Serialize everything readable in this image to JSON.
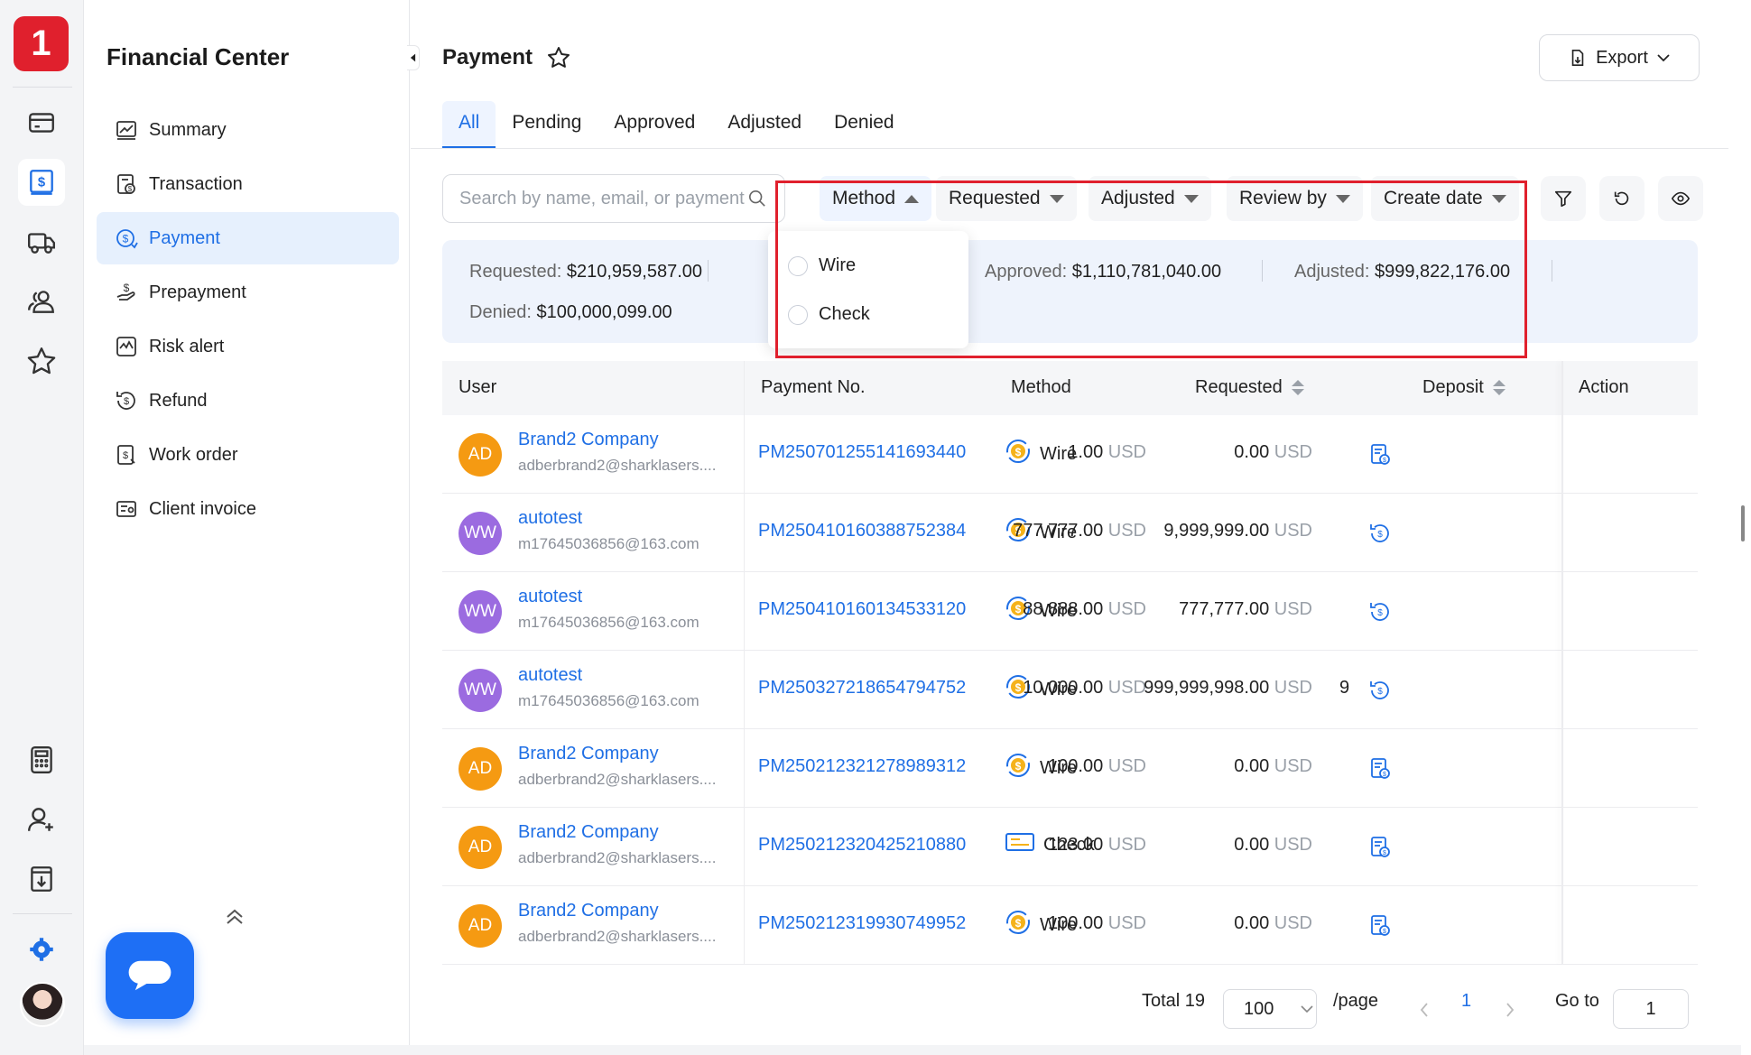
{
  "app": {
    "logo_text": "1",
    "accent": "#1f6fe5",
    "brand_red": "#e0202d"
  },
  "rail": {
    "icons": [
      "card-icon",
      "dollar-doc-icon",
      "truck-icon",
      "users-icon",
      "star-icon",
      "calculator-icon",
      "user-add-icon",
      "download-box-icon",
      "settings-icon"
    ]
  },
  "nav": {
    "title": "Financial Center",
    "items": [
      {
        "label": "Summary",
        "icon": "chart-icon"
      },
      {
        "label": "Transaction",
        "icon": "transaction-icon"
      },
      {
        "label": "Payment",
        "icon": "payment-icon",
        "active": true
      },
      {
        "label": "Prepayment",
        "icon": "prepayment-icon"
      },
      {
        "label": "Risk alert",
        "icon": "risk-alert-icon"
      },
      {
        "label": "Refund",
        "icon": "refund-icon"
      },
      {
        "label": "Work order",
        "icon": "work-order-icon"
      },
      {
        "label": "Client invoice",
        "icon": "client-invoice-icon"
      }
    ]
  },
  "header": {
    "title": "Payment",
    "export_label": "Export"
  },
  "tabs": [
    "All",
    "Pending",
    "Approved",
    "Adjusted",
    "Denied"
  ],
  "search": {
    "placeholder": "Search by name, email, or payment No."
  },
  "filters": [
    "Method",
    "Requested",
    "Adjusted",
    "Review by",
    "Create date"
  ],
  "dropdown": {
    "options": [
      "Wire",
      "Check"
    ]
  },
  "summary": {
    "requested_label": "Requested:",
    "requested_value": "$210,959,587.00",
    "approved_label": "Approved:",
    "approved_value": "$1,110,781,040.00",
    "adjusted_label": "Adjusted:",
    "adjusted_value": "$999,822,176.00",
    "denied_label": "Denied:",
    "denied_value": "$100,000,099.00"
  },
  "table": {
    "headers": {
      "user": "User",
      "payment_no": "Payment No.",
      "method": "Method",
      "requested": "Requested",
      "deposit": "Deposit",
      "action": "Action"
    },
    "currency": "USD",
    "rows": [
      {
        "initials": "AD",
        "avatar_color": "#f59a12",
        "name": "Brand2 Company",
        "email": "adberbrand2@sharklasers....",
        "payment_no": "PM250701255141693440",
        "method": "Wire",
        "requested": "1.00",
        "deposit": "0.00",
        "extra": "",
        "action_icon": "receipt-icon"
      },
      {
        "initials": "WW",
        "avatar_color": "#9b6be0",
        "name": "autotest",
        "email": "m17645036856@163.com",
        "payment_no": "PM250410160388752384",
        "method": "Wire",
        "requested": "777,777.00",
        "deposit": "9,999,999.00",
        "extra": "",
        "action_icon": "review-dollar-icon"
      },
      {
        "initials": "WW",
        "avatar_color": "#9b6be0",
        "name": "autotest",
        "email": "m17645036856@163.com",
        "payment_no": "PM250410160134533120",
        "method": "Wire",
        "requested": "88,888.00",
        "deposit": "777,777.00",
        "extra": "",
        "action_icon": "review-dollar-icon"
      },
      {
        "initials": "WW",
        "avatar_color": "#9b6be0",
        "name": "autotest",
        "email": "m17645036856@163.com",
        "payment_no": "PM250327218654794752",
        "method": "Wire",
        "requested": "10,000.00",
        "deposit": "999,999,998.00",
        "extra": "9",
        "action_icon": "review-dollar-icon"
      },
      {
        "initials": "AD",
        "avatar_color": "#f59a12",
        "name": "Brand2 Company",
        "email": "adberbrand2@sharklasers....",
        "payment_no": "PM250212321278989312",
        "method": "Wire",
        "requested": "100.00",
        "deposit": "0.00",
        "extra": "",
        "action_icon": "receipt-icon"
      },
      {
        "initials": "AD",
        "avatar_color": "#f59a12",
        "name": "Brand2 Company",
        "email": "adberbrand2@sharklasers....",
        "payment_no": "PM250212320425210880",
        "method": "Check",
        "requested": "123.00",
        "deposit": "0.00",
        "extra": "",
        "action_icon": "receipt-icon"
      },
      {
        "initials": "AD",
        "avatar_color": "#f59a12",
        "name": "Brand2 Company",
        "email": "adberbrand2@sharklasers....",
        "payment_no": "PM250212319930749952",
        "method": "Wire",
        "requested": "100.00",
        "deposit": "0.00",
        "extra": "",
        "action_icon": "receipt-icon"
      }
    ]
  },
  "pagination": {
    "total": "Total 19",
    "page_size": "100",
    "per_page": "/page",
    "current": "1",
    "goto_label": "Go to",
    "goto_value": "1"
  }
}
